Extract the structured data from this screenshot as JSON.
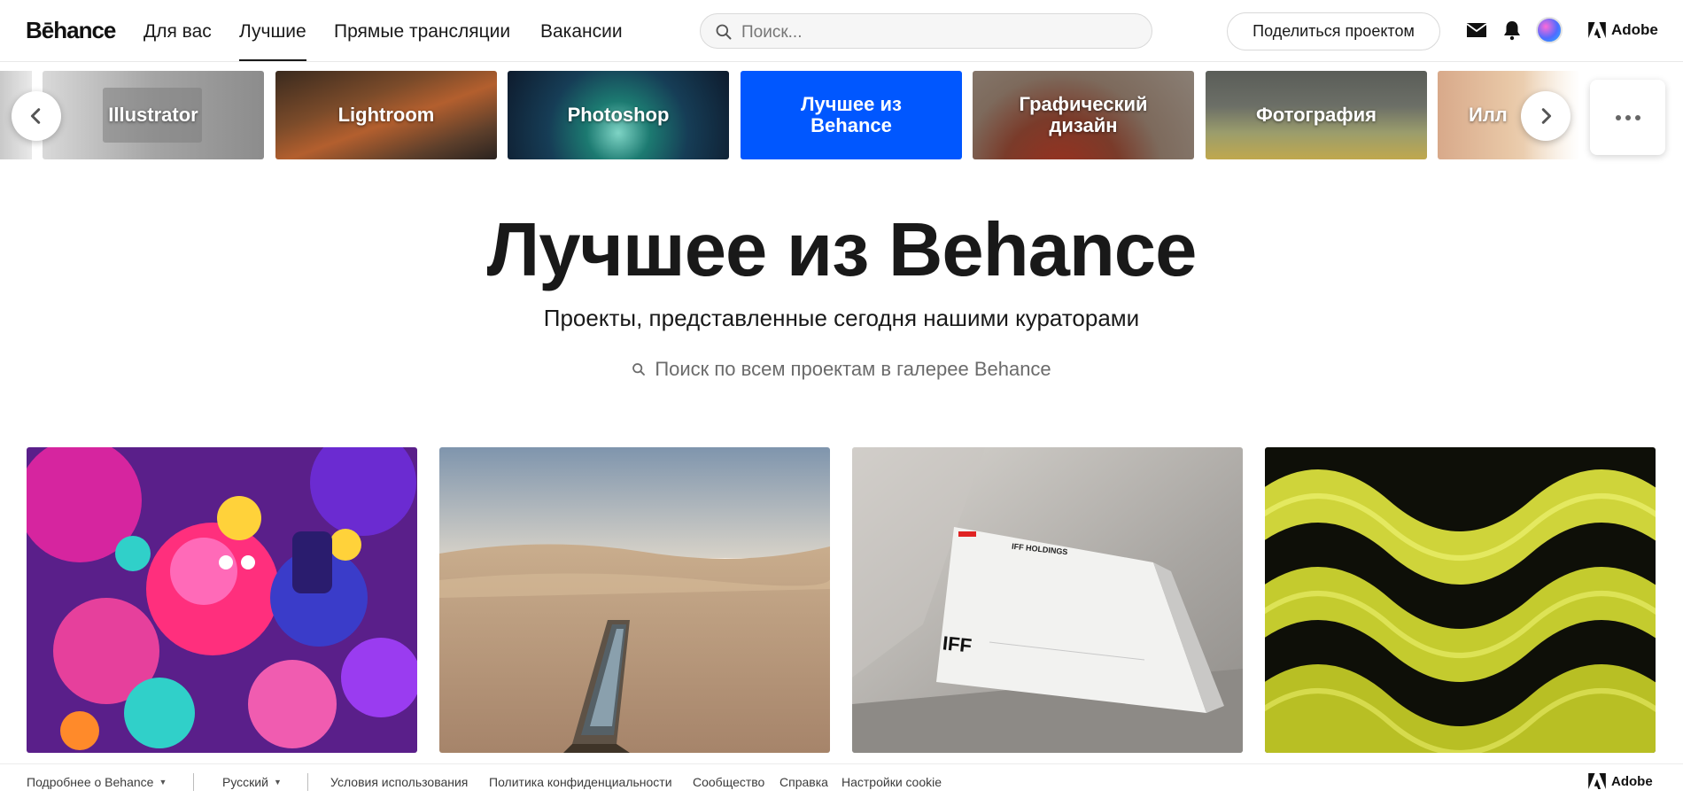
{
  "header": {
    "logo": "Bēhance",
    "nav": [
      {
        "label": "Для вас"
      },
      {
        "label": "Лучшие"
      },
      {
        "label": "Прямые трансляции"
      },
      {
        "label": "Вакансии"
      }
    ],
    "search_placeholder": "Поиск...",
    "share_label": "Поделиться проектом",
    "brand": "Adobe",
    "icons": [
      "search-icon",
      "mail-icon",
      "bell-icon",
      "avatar",
      "adobe-logo-icon"
    ]
  },
  "categories": [
    {
      "label": "Illustrator"
    },
    {
      "label": "Lightroom"
    },
    {
      "label": "Photoshop"
    },
    {
      "label": "Лучшее из Behance"
    },
    {
      "label": "Графический дизайн"
    },
    {
      "label": "Фотография"
    },
    {
      "label": "Илл"
    }
  ],
  "hero": {
    "title": "Лучшее из Behance",
    "subtitle": "Проекты, представленные сегодня нашими кураторами",
    "search_placeholder": "Поиск по всем проектам в галерее Behance"
  },
  "gallery": {
    "card3": {
      "company": "IFF HOLDINGS",
      "logo_text": "IFF"
    }
  },
  "footer": {
    "about": "Подробнее о Behance",
    "language": "Русский",
    "links": [
      "Условия использования",
      "Политика конфиденциальности",
      "Сообщество",
      "Справка",
      "Настройки cookie"
    ],
    "brand": "Adobe"
  },
  "colors": {
    "accent": "#0057ff",
    "text": "#191919"
  }
}
